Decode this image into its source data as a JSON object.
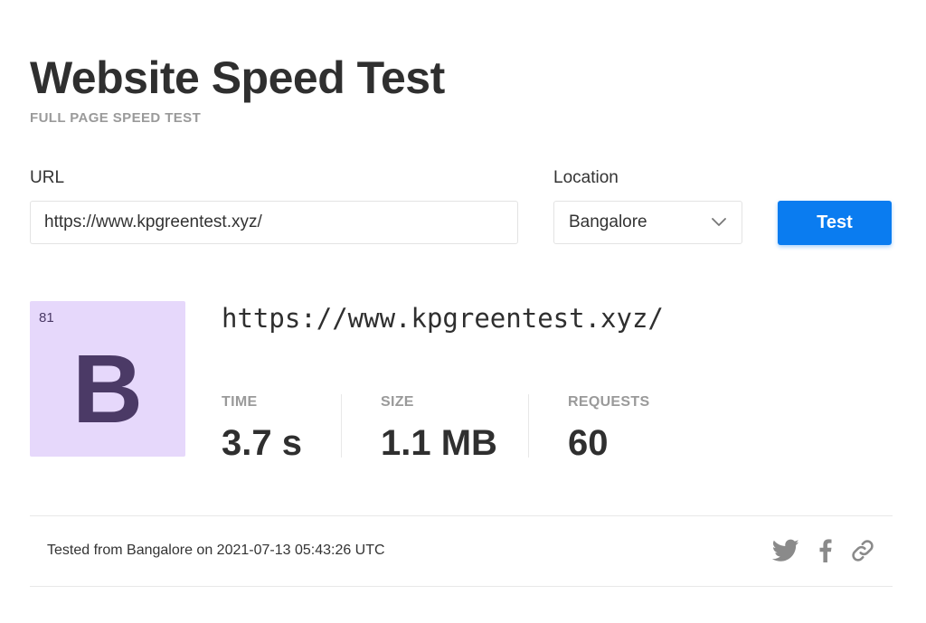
{
  "header": {
    "title": "Website Speed Test",
    "subtitle": "FULL PAGE SPEED TEST"
  },
  "form": {
    "url_label": "URL",
    "url_value": "https://www.kpgreentest.xyz/",
    "location_label": "Location",
    "location_value": "Bangalore",
    "test_button": "Test"
  },
  "result": {
    "score": "81",
    "grade": "B",
    "url": "https://www.kpgreentest.xyz/",
    "metrics": {
      "time_label": "TIME",
      "time_value": "3.7 s",
      "size_label": "SIZE",
      "size_value": "1.1 MB",
      "requests_label": "REQUESTS",
      "requests_value": "60"
    }
  },
  "footer": {
    "tested_text": "Tested from Bangalore on 2021-07-13 05:43:26 UTC",
    "share_icons": [
      "twitter-icon",
      "facebook-icon",
      "link-icon"
    ]
  },
  "colors": {
    "accent": "#0a7cf0",
    "grade_bg": "#e6d8fb",
    "grade_fg": "#4b3a66",
    "muted": "#9a9a9a"
  }
}
